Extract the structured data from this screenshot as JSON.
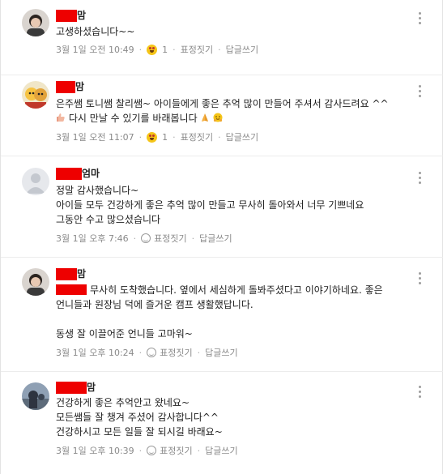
{
  "labels": {
    "reaction": "표정짓기",
    "reply": "답글쓰기"
  },
  "comments": [
    {
      "name_suffix": "맘",
      "lines": [
        "고생하셨습니다~~"
      ],
      "time": "3월 1일 오전 10:49",
      "reaction_count": "1"
    },
    {
      "name_suffix": "맘",
      "lines": [
        "은주쌤 토니쌤 찰리쌤~ 아이들에게 좋은 추억 많이 만들어 주셔서 감사드려요 ^^",
        "다시 만날 수 있기를 바래봅니다"
      ],
      "time": "3월 1일 오전 11:07",
      "reaction_count": "1"
    },
    {
      "name_suffix": "엄마",
      "lines": [
        "정말 감사했습니다~",
        "아이들 모두 건강하게 좋은 추억 많이 만들고 무사히 돌아와서 너무 기쁘네요",
        "그동안 수고 많으셨습니다"
      ],
      "time": "3월 1일 오후 7:46"
    },
    {
      "name_suffix": "맘",
      "lines": [
        "무사히 도착했습니다. 옆에서 세심하게 돌봐주셨다고 이야기하네요. 좋은",
        "언니들과 원장님 덕에 즐거운 캠프 생활했답니다.",
        "",
        "동생 잘 이끌어준 언니들 고마워~"
      ],
      "time": "3월 1일 오후 10:24"
    },
    {
      "name_suffix": "맘",
      "lines": [
        "건강하게 좋은 추억안고 왔네요~",
        "모든쌤들 잘 챙겨 주셨어 감사합니다^^",
        "건강하시고 모든 일들 잘 되시길 바래요~"
      ],
      "time": "3월 1일 오후 10:39"
    }
  ],
  "colors": {
    "redaction": "#ee0000",
    "meta_text": "#8a8a8a"
  },
  "icons": [
    "more-vertical-icon",
    "heart-eyes-emoji-icon",
    "smile-outline-icon",
    "praying-hands-emoji-icon",
    "hugging-face-emoji-icon",
    "thumb-emoji-icon"
  ]
}
